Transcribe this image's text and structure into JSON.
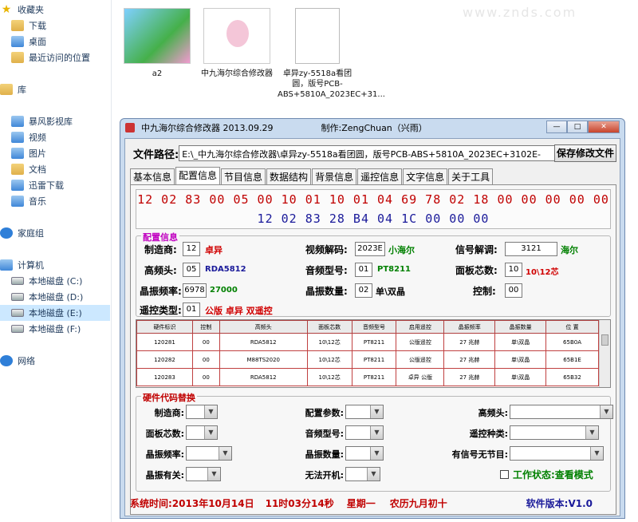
{
  "nav": {
    "favorites": "收藏夹",
    "downloads": "下载",
    "desktop": "桌面",
    "recent": "最近访问的位置",
    "library": "库",
    "storm": "暴风影视库",
    "video": "视频",
    "pictures": "图片",
    "documents": "文档",
    "thunder": "迅雷下载",
    "music": "音乐",
    "homegroup": "家庭组",
    "computer": "计算机",
    "drive_c": "本地磁盘 (C:)",
    "drive_d": "本地磁盘 (D:)",
    "drive_e": "本地磁盘 (E:)",
    "drive_f": "本地磁盘 (F:)",
    "network": "网络"
  },
  "files": {
    "file1": "a2",
    "file2": "中九海尔综合修改器",
    "file3": "卓异zy-5518a看团圆，版号PCB-ABS+5810A_2023EC+31...",
    "watermark": "www.znds.com"
  },
  "window": {
    "title": "中九海尔综合修改器 2013.09.29",
    "author": "制作:ZengChuan（兴雨）",
    "path_label": "文件路径:",
    "path_value": "E:\\_中九海尔综合修改器\\卓异zy-5518a看团圆，版号PCB-ABS+5810A_2023EC+3102E-",
    "save_button": "保存修改文件",
    "tabs": [
      "基本信息",
      "配置信息",
      "节目信息",
      "数据结构",
      "背景信息",
      "遥控信息",
      "文字信息",
      "关于工具"
    ],
    "hex_line1": "12 02 83 00 05 00 10 01 10 01 04 69 78 02 18 00 00 00 00 00",
    "hex_line2": "12 02 83 28 B4 04 1C 00 00 00"
  },
  "config": {
    "group_title": "配置信息",
    "manufacturer_label": "制造商:",
    "manufacturer_value": "12",
    "manufacturer_name": "卓异",
    "video_decode_label": "视频解码:",
    "video_decode_value": "2023E",
    "video_decode_name": "小海尔",
    "signal_decode_label": "信号解调:",
    "signal_decode_value": "3121",
    "signal_decode_name": "海尔",
    "tuner_label": "高频头:",
    "tuner_value": "05",
    "tuner_name": "RDA5812",
    "audio_label": "音频型号:",
    "audio_value": "01",
    "audio_name": "PT8211",
    "panel_label": "面板芯数:",
    "panel_value": "10",
    "panel_name": "10\\12芯",
    "crystal_label": "晶振频率:",
    "crystal_value": "6978",
    "crystal_name": "27000",
    "crystal_count_label": "晶振数量:",
    "crystal_count_value": "02",
    "crystal_count_name": "单\\双晶",
    "control_label": "控制:",
    "control_value": "00",
    "remote_label": "遥控类型:",
    "remote_value": "01",
    "remote_name": "公版 卓异 双遥控"
  },
  "hw_table": {
    "headers": [
      "硬件标识",
      "控制",
      "高频头",
      "面板芯数",
      "音频型号",
      "启用遥控",
      "晶振频率",
      "晶振数量",
      "位 置"
    ],
    "rows": [
      [
        "120281",
        "00",
        "RDA5812",
        "10\\12芯",
        "PT8211",
        "公版遥控",
        "27 兆赫",
        "单\\双晶",
        "65B0A"
      ],
      [
        "120282",
        "00",
        "M88TS2020",
        "10\\12芯",
        "PT8211",
        "公版遥控",
        "27 兆赫",
        "单\\双晶",
        "65B1E"
      ],
      [
        "120283",
        "00",
        "RDA5812",
        "10\\12芯",
        "PT8211",
        "卓异 公版",
        "27 兆赫",
        "单\\双晶",
        "65B32"
      ]
    ]
  },
  "replace": {
    "group_title": "硬件代码替换",
    "manufacturer": "制造商:",
    "config_param": "配置参数:",
    "tuner": "高频头:",
    "panel": "面板芯数:",
    "audio": "音频型号:",
    "remote_kind": "遥控种类:",
    "crystal_freq": "晶振频率:",
    "crystal_count": "晶振数量:",
    "signal_check": "有信号无节目:",
    "crystal_related": "晶振有关:",
    "no_boot": "无法开机:",
    "work_state": "工作状态:查看模式"
  },
  "status": {
    "system_time": "系统时间:2013年10月14日",
    "clock": "11时03分14秒",
    "weekday": "星期一",
    "lunar": "农历九月初十",
    "version": "软件版本:V1.0"
  },
  "colors": {
    "red": "#c00000",
    "green": "#008000",
    "blue": "#1a1a9a"
  }
}
